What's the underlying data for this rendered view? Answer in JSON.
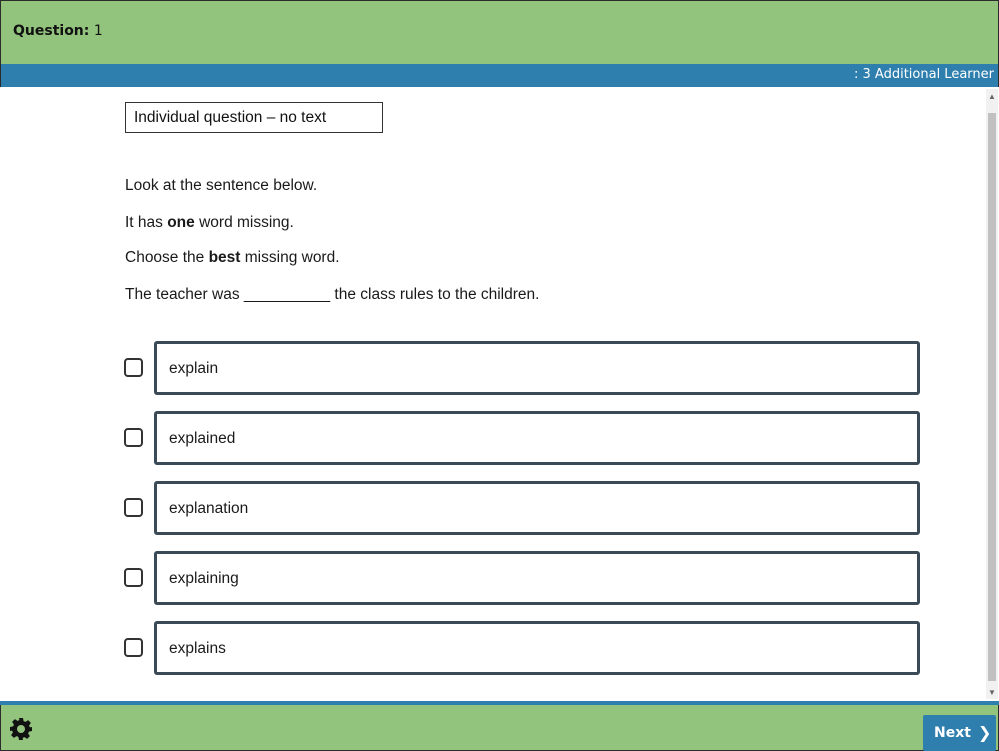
{
  "header": {
    "question_label": "Question:",
    "question_number": "1",
    "section_title": ": 3 Additional Learner"
  },
  "question": {
    "tag": "Individual question – no text",
    "line1": "Look at the sentence below.",
    "line2_pre": "It has ",
    "line2_bold": "one",
    "line2_post": " word missing.",
    "line3_pre": "Choose the ",
    "line3_bold": "best",
    "line3_post": " missing word.",
    "sentence": "The teacher was __________ the class rules to the children."
  },
  "options": [
    {
      "label": "explain",
      "checked": false
    },
    {
      "label": "explained",
      "checked": false
    },
    {
      "label": "explanation",
      "checked": false
    },
    {
      "label": "explaining",
      "checked": false
    },
    {
      "label": "explains",
      "checked": false
    }
  ],
  "footer": {
    "settings_icon": "gear-icon",
    "next_label": "Next",
    "next_icon": "chevron-right-icon"
  },
  "colors": {
    "header_green": "#93c47d",
    "accent_blue": "#2f7fae",
    "option_border": "#3a4a56"
  }
}
